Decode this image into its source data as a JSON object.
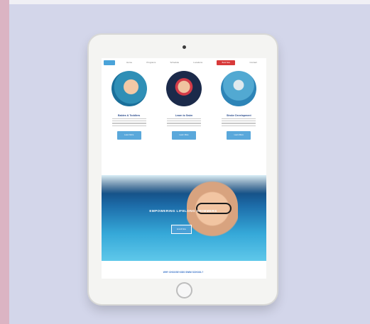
{
  "colors": {
    "background": "#d3d6ea",
    "pink_strip": "#dbb4c3",
    "brand_blue": "#4aa3d9",
    "nav_cta_red": "#d83a3a",
    "heading_blue": "#2a4b8d"
  },
  "nav": {
    "items": [
      "Home",
      "Programs",
      "Schedule",
      "Locations",
      "Contact"
    ],
    "cta_label": "Book Now"
  },
  "cards": [
    {
      "title": "Babies & Toddlers",
      "button": "Learn More",
      "image": "baby-swimming-photo"
    },
    {
      "title": "Learn to Swim",
      "button": "Learn More",
      "image": "child-goggles-photo"
    },
    {
      "title": "Stroke Development",
      "button": "Learn More",
      "image": "underwater-swimmer-photo"
    }
  ],
  "hero": {
    "title": "EMPOWERING LIFELONG SWIMMERS",
    "button": "Enroll Now",
    "image": "boy-underwater-thumbs-up"
  },
  "footer": {
    "link": "WHY CHOOSE KIDS SWIM SCHOOL?"
  }
}
